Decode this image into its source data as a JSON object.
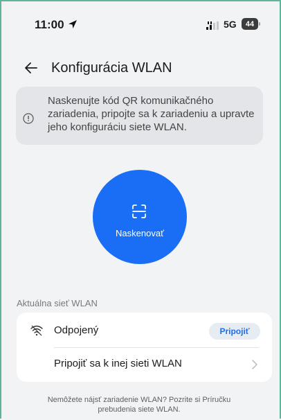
{
  "status_bar": {
    "time": "11:00",
    "network": "5G",
    "battery": "44"
  },
  "header": {
    "title": "Konfigurácia WLAN"
  },
  "info": {
    "text": "Naskenujte kód QR komunikačného zariadenia, pripojte sa k zariadeniu a upravte jeho konfiguráciu siete WLAN."
  },
  "scan": {
    "label": "Naskenovať",
    "color": "#1a6ef5"
  },
  "wlan_section": {
    "label": "Aktuálna sieť WLAN",
    "current": {
      "status": "Odpojený",
      "connect_label": "Pripojiť"
    },
    "other": {
      "label": "Pripojiť sa k inej sieti WLAN"
    }
  },
  "footer": {
    "text": "Nemôžete nájsť zariadenie WLAN? Pozrite si ",
    "link": "Príručku prebudenia siete WLAN."
  },
  "icons": [
    "location-arrow-icon",
    "signal-icon",
    "back-arrow-icon",
    "info-icon",
    "scan-frame-icon",
    "wifi-off-icon",
    "chevron-right-icon"
  ]
}
